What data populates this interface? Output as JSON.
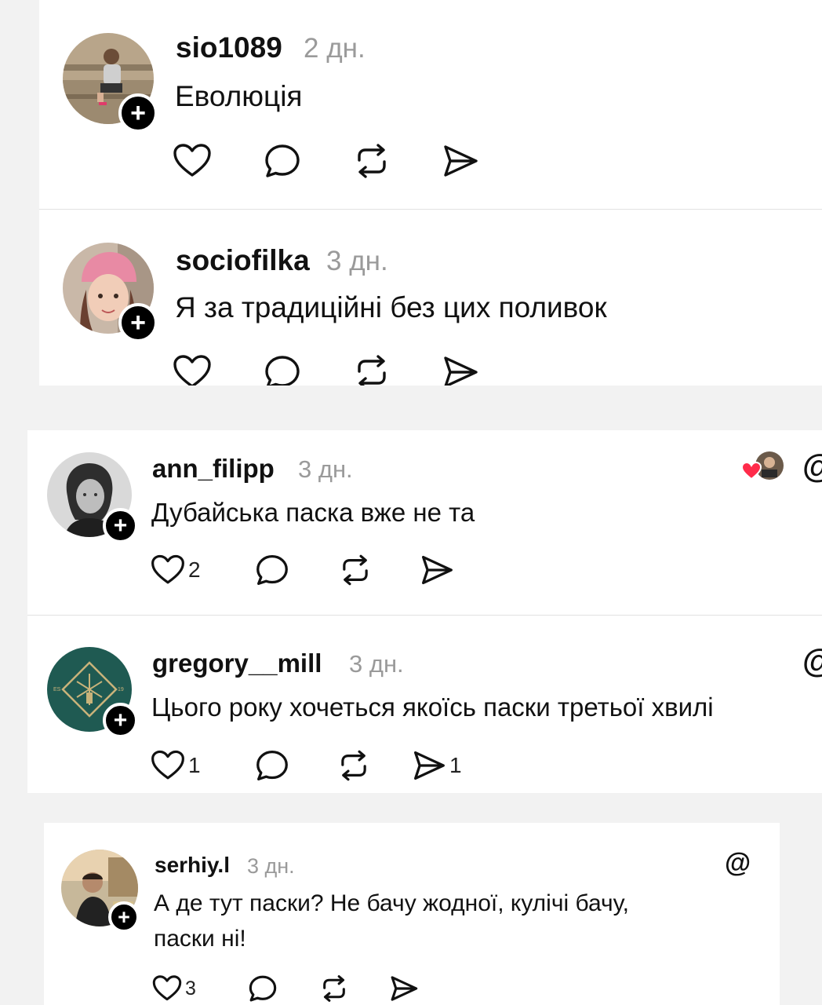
{
  "comments": [
    {
      "username": "sio1089",
      "time": "2 дн.",
      "text": "Еволюція",
      "likes": "",
      "reposts": "",
      "shares": ""
    },
    {
      "username": "sociofilka",
      "time": "3 дн.",
      "text": "Я за традиційні без цих поливок",
      "likes": "",
      "reposts": "",
      "shares": ""
    },
    {
      "username": "ann_filipp",
      "time": "3 дн.",
      "text": "Дубайська паска вже не та",
      "likes": "2",
      "reposts": "",
      "shares": ""
    },
    {
      "username": "gregory__mill",
      "time": "3 дн.",
      "text": "Цього року хочеться якоїсь паски третьої хвилі",
      "likes": "1",
      "reposts": "",
      "shares": "1"
    },
    {
      "username": "serhiy.l",
      "time": "3 дн.",
      "text_line1": "А де тут паски? Не бачу жодної, кулічі бачу,",
      "text_line2": "паски ні!",
      "likes": "3",
      "reposts": "",
      "shares": ""
    }
  ],
  "icons": {
    "follow": "plus-icon",
    "like": "heart-icon",
    "reply": "speech-bubble-icon",
    "repost": "repost-icon",
    "share": "send-icon",
    "threads": "threads-logo-icon"
  },
  "threads_glyph": "@",
  "follow_glyph": "+",
  "colors": {
    "accent_heart": "#ff2b4a",
    "muted_text": "#9a9a9a",
    "badge": "#000000"
  }
}
